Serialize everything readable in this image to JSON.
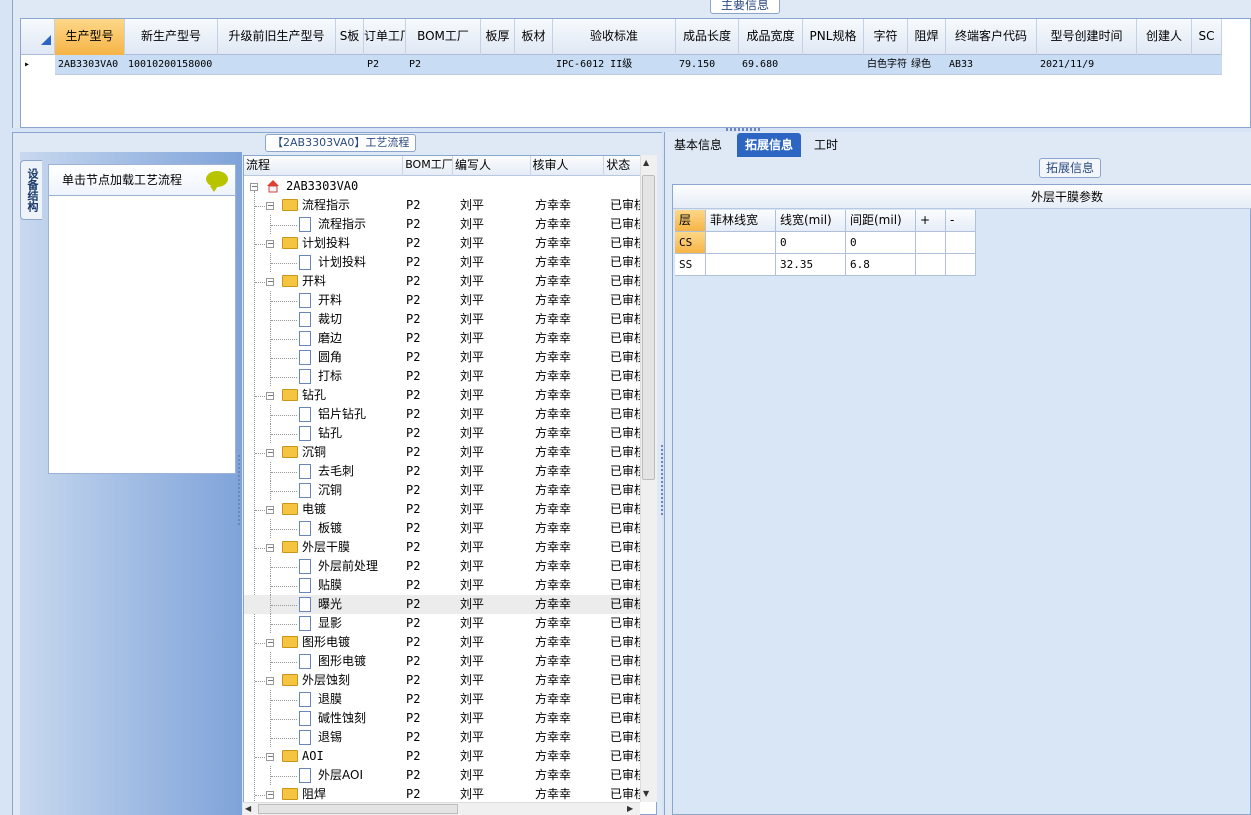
{
  "main": {
    "title": "主要信息",
    "columns": [
      {
        "label": "生产型号",
        "value": "2AB3303VA0",
        "active": true
      },
      {
        "label": "新生产型号",
        "value": "10010200158000"
      },
      {
        "label": "升级前旧生产型号",
        "value": ""
      },
      {
        "label": "S板",
        "value": ""
      },
      {
        "label": "订单工厂",
        "value": "P2"
      },
      {
        "label": "BOM工厂",
        "value": "P2"
      },
      {
        "label": "板厚",
        "value": ""
      },
      {
        "label": "板材",
        "value": ""
      },
      {
        "label": "验收标准",
        "value": "IPC-6012 II级"
      },
      {
        "label": "成品长度",
        "value": "79.150"
      },
      {
        "label": "成品宽度",
        "value": "69.680"
      },
      {
        "label": "PNL规格",
        "value": ""
      },
      {
        "label": "字符",
        "value": "白色字符"
      },
      {
        "label": "阻焊",
        "value": "绿色"
      },
      {
        "label": "终端客户代码",
        "value": "AB33"
      },
      {
        "label": "型号创建时间",
        "value": "2021/11/9"
      },
      {
        "label": "创建人",
        "value": ""
      },
      {
        "label": "SC",
        "value": ""
      }
    ]
  },
  "flow": {
    "title": "【2AB3303VA0】工艺流程",
    "side_tab": "设备结构",
    "node_hint": "单击节点加载工艺流程",
    "headers": [
      "流程",
      "BOM工厂",
      "编写人",
      "核审人",
      "状态"
    ],
    "root": "2AB3303VA0",
    "rows": [
      {
        "name": "流程指示",
        "level": 1,
        "type": "folder",
        "bom": "P2",
        "writer": "刘平",
        "reviewer": "方幸幸",
        "status": "已审核"
      },
      {
        "name": "流程指示",
        "level": 2,
        "type": "doc",
        "bom": "P2",
        "writer": "刘平",
        "reviewer": "方幸幸",
        "status": "已审核"
      },
      {
        "name": "计划投料",
        "level": 1,
        "type": "folder",
        "bom": "P2",
        "writer": "刘平",
        "reviewer": "方幸幸",
        "status": "已审核"
      },
      {
        "name": "计划投料",
        "level": 2,
        "type": "doc",
        "bom": "P2",
        "writer": "刘平",
        "reviewer": "方幸幸",
        "status": "已审核"
      },
      {
        "name": "开料",
        "level": 1,
        "type": "folder",
        "bom": "P2",
        "writer": "刘平",
        "reviewer": "方幸幸",
        "status": "已审核"
      },
      {
        "name": "开料",
        "level": 2,
        "type": "doc",
        "bom": "P2",
        "writer": "刘平",
        "reviewer": "方幸幸",
        "status": "已审核"
      },
      {
        "name": "裁切",
        "level": 2,
        "type": "doc",
        "bom": "P2",
        "writer": "刘平",
        "reviewer": "方幸幸",
        "status": "已审核"
      },
      {
        "name": "磨边",
        "level": 2,
        "type": "doc",
        "bom": "P2",
        "writer": "刘平",
        "reviewer": "方幸幸",
        "status": "已审核"
      },
      {
        "name": "圆角",
        "level": 2,
        "type": "doc",
        "bom": "P2",
        "writer": "刘平",
        "reviewer": "方幸幸",
        "status": "已审核"
      },
      {
        "name": "打标",
        "level": 2,
        "type": "doc",
        "bom": "P2",
        "writer": "刘平",
        "reviewer": "方幸幸",
        "status": "已审核"
      },
      {
        "name": "钻孔",
        "level": 1,
        "type": "folder",
        "bom": "P2",
        "writer": "刘平",
        "reviewer": "方幸幸",
        "status": "已审核"
      },
      {
        "name": "铝片钻孔",
        "level": 2,
        "type": "doc",
        "bom": "P2",
        "writer": "刘平",
        "reviewer": "方幸幸",
        "status": "已审核"
      },
      {
        "name": "钻孔",
        "level": 2,
        "type": "doc",
        "bom": "P2",
        "writer": "刘平",
        "reviewer": "方幸幸",
        "status": "已审核"
      },
      {
        "name": "沉铜",
        "level": 1,
        "type": "folder",
        "bom": "P2",
        "writer": "刘平",
        "reviewer": "方幸幸",
        "status": "已审核"
      },
      {
        "name": "去毛刺",
        "level": 2,
        "type": "doc",
        "bom": "P2",
        "writer": "刘平",
        "reviewer": "方幸幸",
        "status": "已审核"
      },
      {
        "name": "沉铜",
        "level": 2,
        "type": "doc",
        "bom": "P2",
        "writer": "刘平",
        "reviewer": "方幸幸",
        "status": "已审核"
      },
      {
        "name": "电镀",
        "level": 1,
        "type": "folder",
        "bom": "P2",
        "writer": "刘平",
        "reviewer": "方幸幸",
        "status": "已审核"
      },
      {
        "name": "板镀",
        "level": 2,
        "type": "doc",
        "bom": "P2",
        "writer": "刘平",
        "reviewer": "方幸幸",
        "status": "已审核"
      },
      {
        "name": "外层干膜",
        "level": 1,
        "type": "folder",
        "bom": "P2",
        "writer": "刘平",
        "reviewer": "方幸幸",
        "status": "已审核"
      },
      {
        "name": "外层前处理",
        "level": 2,
        "type": "doc",
        "bom": "P2",
        "writer": "刘平",
        "reviewer": "方幸幸",
        "status": "已审核"
      },
      {
        "name": "贴膜",
        "level": 2,
        "type": "doc",
        "bom": "P2",
        "writer": "刘平",
        "reviewer": "方幸幸",
        "status": "已审核"
      },
      {
        "name": "曝光",
        "level": 2,
        "type": "doc",
        "bom": "P2",
        "writer": "刘平",
        "reviewer": "方幸幸",
        "status": "已审核",
        "selected": true
      },
      {
        "name": "显影",
        "level": 2,
        "type": "doc",
        "bom": "P2",
        "writer": "刘平",
        "reviewer": "方幸幸",
        "status": "已审核"
      },
      {
        "name": "图形电镀",
        "level": 1,
        "type": "folder",
        "bom": "P2",
        "writer": "刘平",
        "reviewer": "方幸幸",
        "status": "已审核"
      },
      {
        "name": "图形电镀",
        "level": 2,
        "type": "doc",
        "bom": "P2",
        "writer": "刘平",
        "reviewer": "方幸幸",
        "status": "已审核"
      },
      {
        "name": "外层蚀刻",
        "level": 1,
        "type": "folder",
        "bom": "P2",
        "writer": "刘平",
        "reviewer": "方幸幸",
        "status": "已审核"
      },
      {
        "name": "退膜",
        "level": 2,
        "type": "doc",
        "bom": "P2",
        "writer": "刘平",
        "reviewer": "方幸幸",
        "status": "已审核"
      },
      {
        "name": "碱性蚀刻",
        "level": 2,
        "type": "doc",
        "bom": "P2",
        "writer": "刘平",
        "reviewer": "方幸幸",
        "status": "已审核"
      },
      {
        "name": "退锡",
        "level": 2,
        "type": "doc",
        "bom": "P2",
        "writer": "刘平",
        "reviewer": "方幸幸",
        "status": "已审核"
      },
      {
        "name": "AOI",
        "level": 1,
        "type": "folder",
        "bom": "P2",
        "writer": "刘平",
        "reviewer": "方幸幸",
        "status": "已审核"
      },
      {
        "name": "外层AOI",
        "level": 2,
        "type": "doc",
        "bom": "P2",
        "writer": "刘平",
        "reviewer": "方幸幸",
        "status": "已审核"
      },
      {
        "name": "阻焊",
        "level": 1,
        "type": "folder",
        "bom": "P2",
        "writer": "刘平",
        "reviewer": "方幸幸",
        "status": "已审核"
      }
    ]
  },
  "detail": {
    "tabs": [
      {
        "label": "基本信息",
        "active": false
      },
      {
        "label": "拓展信息",
        "active": true
      },
      {
        "label": "工时",
        "active": false
      }
    ],
    "section_title": "拓展信息",
    "group_title": "外层干膜参数",
    "headers": [
      "层",
      "菲林线宽",
      "线宽(mil)",
      "间距(mil)",
      "+",
      "-"
    ],
    "rows": [
      [
        "CS",
        "",
        "0",
        "0",
        "",
        ""
      ],
      [
        "SS",
        "",
        "32.35",
        "6.8",
        "",
        ""
      ]
    ]
  }
}
